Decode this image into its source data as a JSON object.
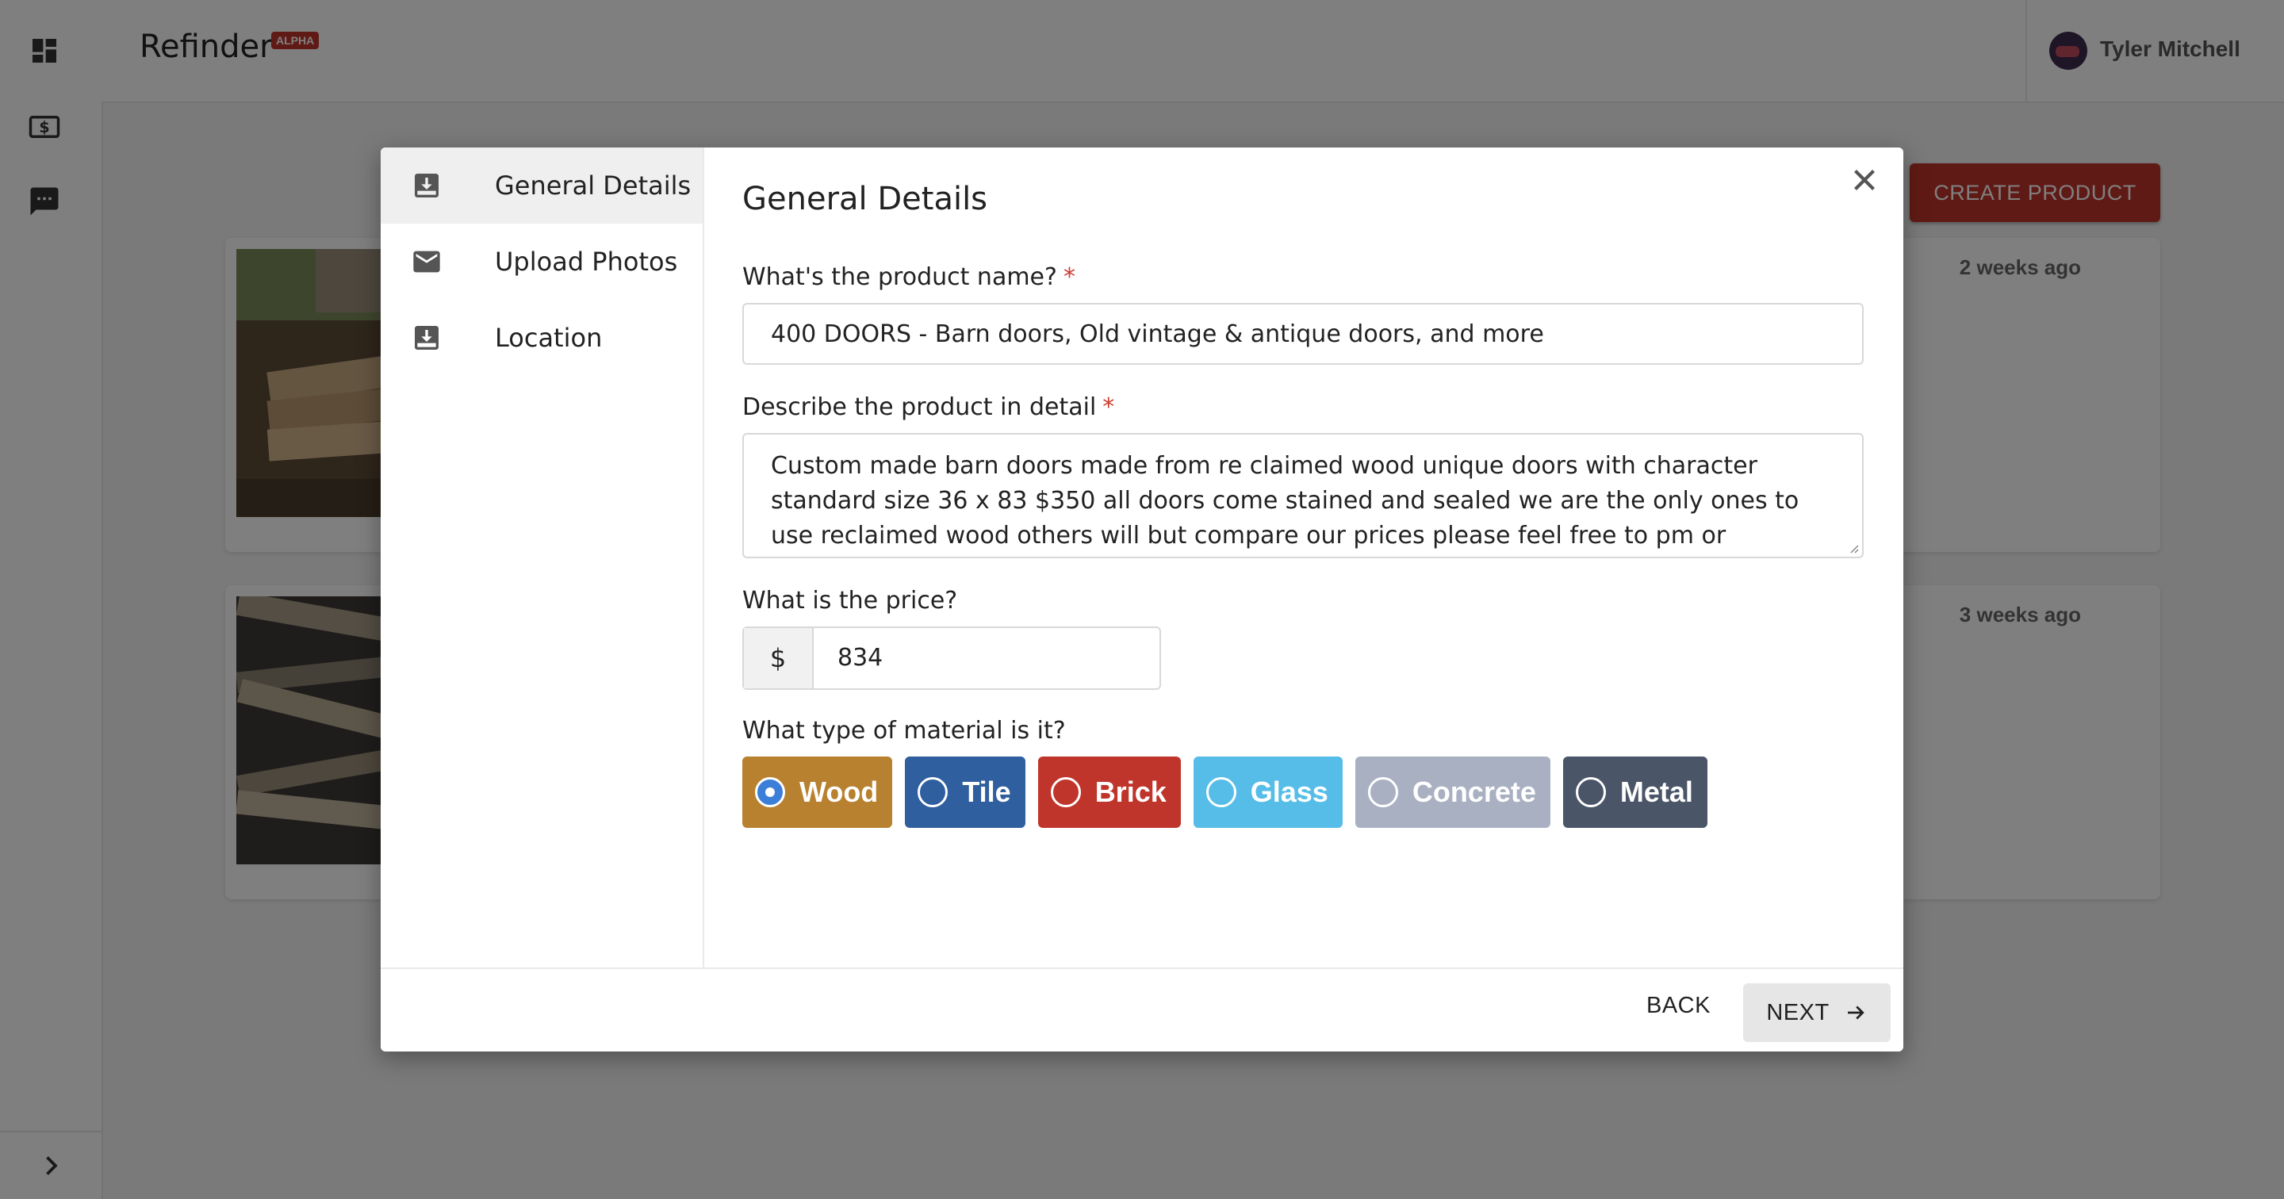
{
  "app": {
    "brand": "Refinder",
    "badge": "ALPHA"
  },
  "sidebar": {
    "items": [
      {
        "icon": "dashboard-icon"
      },
      {
        "icon": "dollar-icon"
      },
      {
        "icon": "chat-icon"
      }
    ],
    "expand_icon": "chevron-right-icon"
  },
  "header": {
    "user_name": "Tyler Mitchell"
  },
  "page": {
    "create_button": "CREATE PRODUCT",
    "cards": [
      {
        "time": "2 weeks ago"
      },
      {
        "time": "3 weeks ago"
      }
    ]
  },
  "modal": {
    "nav": [
      {
        "label": "General Details",
        "icon": "download-box-icon",
        "active": true
      },
      {
        "label": "Upload Photos",
        "icon": "envelope-icon",
        "active": false
      },
      {
        "label": "Location",
        "icon": "download-box-icon",
        "active": false
      }
    ],
    "title": "General Details",
    "name_label": "What's the product name?",
    "name_value": "400 DOORS - Barn doors, Old vintage & antique doors, and more",
    "description_label": "Describe the product in detail",
    "description_value": "Custom made barn doors made from re claimed wood unique doors with character standard size 36 x 83 $350 all doors come stained and sealed we are the only ones to use reclaimed wood others will but compare our prices please feel free to pm or",
    "required_mark": "*",
    "price_label": "What is the price?",
    "price_prefix": "$",
    "price_value": "834",
    "material_label": "What type of material is it?",
    "materials": [
      {
        "label": "Wood",
        "color": "#b8812f",
        "checked": true
      },
      {
        "label": "Tile",
        "color": "#2f5f9e",
        "checked": false
      },
      {
        "label": "Brick",
        "color": "#c0352b",
        "checked": false
      },
      {
        "label": "Glass",
        "color": "#55bde8",
        "checked": false
      },
      {
        "label": "Concrete",
        "color": "#a8b0c2",
        "checked": false
      },
      {
        "label": "Metal",
        "color": "#4a5568",
        "checked": false
      }
    ],
    "back_label": "BACK",
    "next_label": "NEXT"
  }
}
